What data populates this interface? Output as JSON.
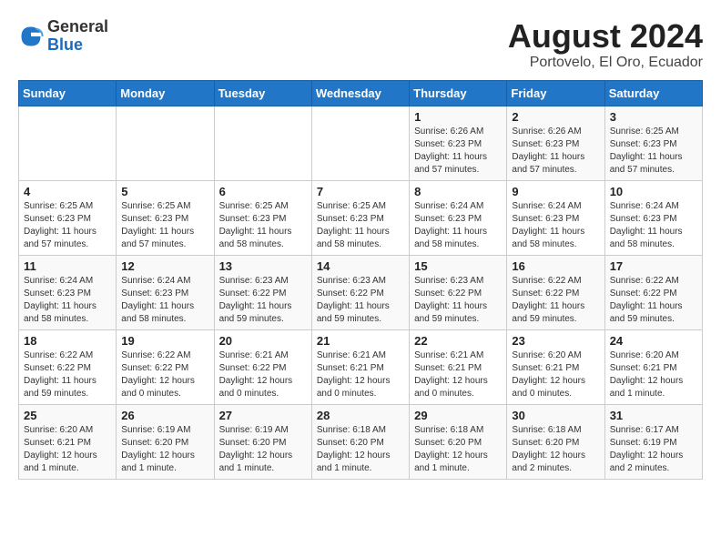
{
  "header": {
    "logo_general": "General",
    "logo_blue": "Blue",
    "month_year": "August 2024",
    "location": "Portovelo, El Oro, Ecuador"
  },
  "calendar": {
    "days_of_week": [
      "Sunday",
      "Monday",
      "Tuesday",
      "Wednesday",
      "Thursday",
      "Friday",
      "Saturday"
    ],
    "weeks": [
      [
        {
          "day": "",
          "info": ""
        },
        {
          "day": "",
          "info": ""
        },
        {
          "day": "",
          "info": ""
        },
        {
          "day": "",
          "info": ""
        },
        {
          "day": "1",
          "info": "Sunrise: 6:26 AM\nSunset: 6:23 PM\nDaylight: 11 hours and 57 minutes."
        },
        {
          "day": "2",
          "info": "Sunrise: 6:26 AM\nSunset: 6:23 PM\nDaylight: 11 hours and 57 minutes."
        },
        {
          "day": "3",
          "info": "Sunrise: 6:25 AM\nSunset: 6:23 PM\nDaylight: 11 hours and 57 minutes."
        }
      ],
      [
        {
          "day": "4",
          "info": "Sunrise: 6:25 AM\nSunset: 6:23 PM\nDaylight: 11 hours and 57 minutes."
        },
        {
          "day": "5",
          "info": "Sunrise: 6:25 AM\nSunset: 6:23 PM\nDaylight: 11 hours and 57 minutes."
        },
        {
          "day": "6",
          "info": "Sunrise: 6:25 AM\nSunset: 6:23 PM\nDaylight: 11 hours and 58 minutes."
        },
        {
          "day": "7",
          "info": "Sunrise: 6:25 AM\nSunset: 6:23 PM\nDaylight: 11 hours and 58 minutes."
        },
        {
          "day": "8",
          "info": "Sunrise: 6:24 AM\nSunset: 6:23 PM\nDaylight: 11 hours and 58 minutes."
        },
        {
          "day": "9",
          "info": "Sunrise: 6:24 AM\nSunset: 6:23 PM\nDaylight: 11 hours and 58 minutes."
        },
        {
          "day": "10",
          "info": "Sunrise: 6:24 AM\nSunset: 6:23 PM\nDaylight: 11 hours and 58 minutes."
        }
      ],
      [
        {
          "day": "11",
          "info": "Sunrise: 6:24 AM\nSunset: 6:23 PM\nDaylight: 11 hours and 58 minutes."
        },
        {
          "day": "12",
          "info": "Sunrise: 6:24 AM\nSunset: 6:23 PM\nDaylight: 11 hours and 58 minutes."
        },
        {
          "day": "13",
          "info": "Sunrise: 6:23 AM\nSunset: 6:22 PM\nDaylight: 11 hours and 59 minutes."
        },
        {
          "day": "14",
          "info": "Sunrise: 6:23 AM\nSunset: 6:22 PM\nDaylight: 11 hours and 59 minutes."
        },
        {
          "day": "15",
          "info": "Sunrise: 6:23 AM\nSunset: 6:22 PM\nDaylight: 11 hours and 59 minutes."
        },
        {
          "day": "16",
          "info": "Sunrise: 6:22 AM\nSunset: 6:22 PM\nDaylight: 11 hours and 59 minutes."
        },
        {
          "day": "17",
          "info": "Sunrise: 6:22 AM\nSunset: 6:22 PM\nDaylight: 11 hours and 59 minutes."
        }
      ],
      [
        {
          "day": "18",
          "info": "Sunrise: 6:22 AM\nSunset: 6:22 PM\nDaylight: 11 hours and 59 minutes."
        },
        {
          "day": "19",
          "info": "Sunrise: 6:22 AM\nSunset: 6:22 PM\nDaylight: 12 hours and 0 minutes."
        },
        {
          "day": "20",
          "info": "Sunrise: 6:21 AM\nSunset: 6:22 PM\nDaylight: 12 hours and 0 minutes."
        },
        {
          "day": "21",
          "info": "Sunrise: 6:21 AM\nSunset: 6:21 PM\nDaylight: 12 hours and 0 minutes."
        },
        {
          "day": "22",
          "info": "Sunrise: 6:21 AM\nSunset: 6:21 PM\nDaylight: 12 hours and 0 minutes."
        },
        {
          "day": "23",
          "info": "Sunrise: 6:20 AM\nSunset: 6:21 PM\nDaylight: 12 hours and 0 minutes."
        },
        {
          "day": "24",
          "info": "Sunrise: 6:20 AM\nSunset: 6:21 PM\nDaylight: 12 hours and 1 minute."
        }
      ],
      [
        {
          "day": "25",
          "info": "Sunrise: 6:20 AM\nSunset: 6:21 PM\nDaylight: 12 hours and 1 minute."
        },
        {
          "day": "26",
          "info": "Sunrise: 6:19 AM\nSunset: 6:20 PM\nDaylight: 12 hours and 1 minute."
        },
        {
          "day": "27",
          "info": "Sunrise: 6:19 AM\nSunset: 6:20 PM\nDaylight: 12 hours and 1 minute."
        },
        {
          "day": "28",
          "info": "Sunrise: 6:18 AM\nSunset: 6:20 PM\nDaylight: 12 hours and 1 minute."
        },
        {
          "day": "29",
          "info": "Sunrise: 6:18 AM\nSunset: 6:20 PM\nDaylight: 12 hours and 1 minute."
        },
        {
          "day": "30",
          "info": "Sunrise: 6:18 AM\nSunset: 6:20 PM\nDaylight: 12 hours and 2 minutes."
        },
        {
          "day": "31",
          "info": "Sunrise: 6:17 AM\nSunset: 6:19 PM\nDaylight: 12 hours and 2 minutes."
        }
      ]
    ]
  }
}
